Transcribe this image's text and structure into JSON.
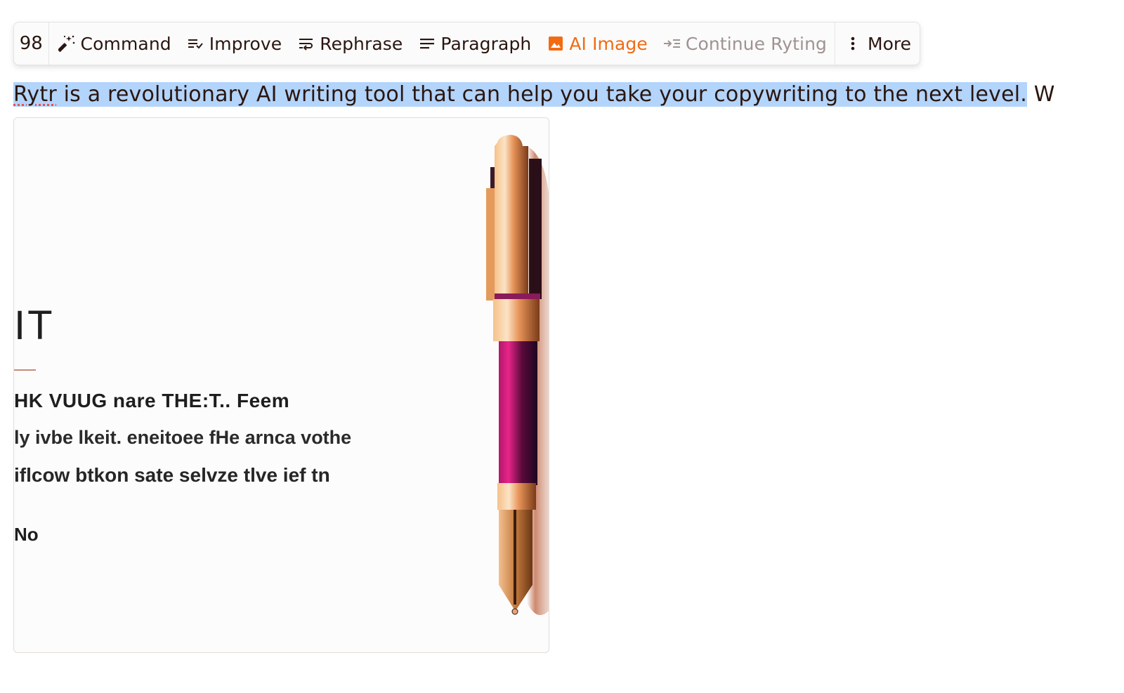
{
  "toolbar": {
    "word_count": "98",
    "buttons": [
      {
        "label": "Command",
        "icon": "magic-wand-icon"
      },
      {
        "label": "Improve",
        "icon": "improve-lines-icon"
      },
      {
        "label": "Rephrase",
        "icon": "rephrase-icon"
      },
      {
        "label": "Paragraph",
        "icon": "paragraph-icon"
      },
      {
        "label": "AI Image",
        "icon": "image-icon",
        "accent": "#f26b12"
      },
      {
        "label": "Continue Ryting",
        "icon": "continue-icon",
        "disabled": true
      }
    ],
    "more_label": "More",
    "more_icon": "vertical-dots-icon"
  },
  "editor": {
    "misspelled_word": "Rytr",
    "selected_text": " is a revolutionary AI writing tool that can help you take your copywriting to the next level.",
    "trailing_text": " W",
    "selection_color": "#b3d4fb"
  },
  "generated_image": {
    "description": "AI generated image of a fountain pen on a document",
    "text_lines": [
      "IT",
      "HK VUUG nare THE:T.. Feem",
      "ly ivbe lkeit. eneitoee fHe arnca vothe",
      "iflcow btkon sate selvze tlve ief tn",
      "No"
    ]
  }
}
